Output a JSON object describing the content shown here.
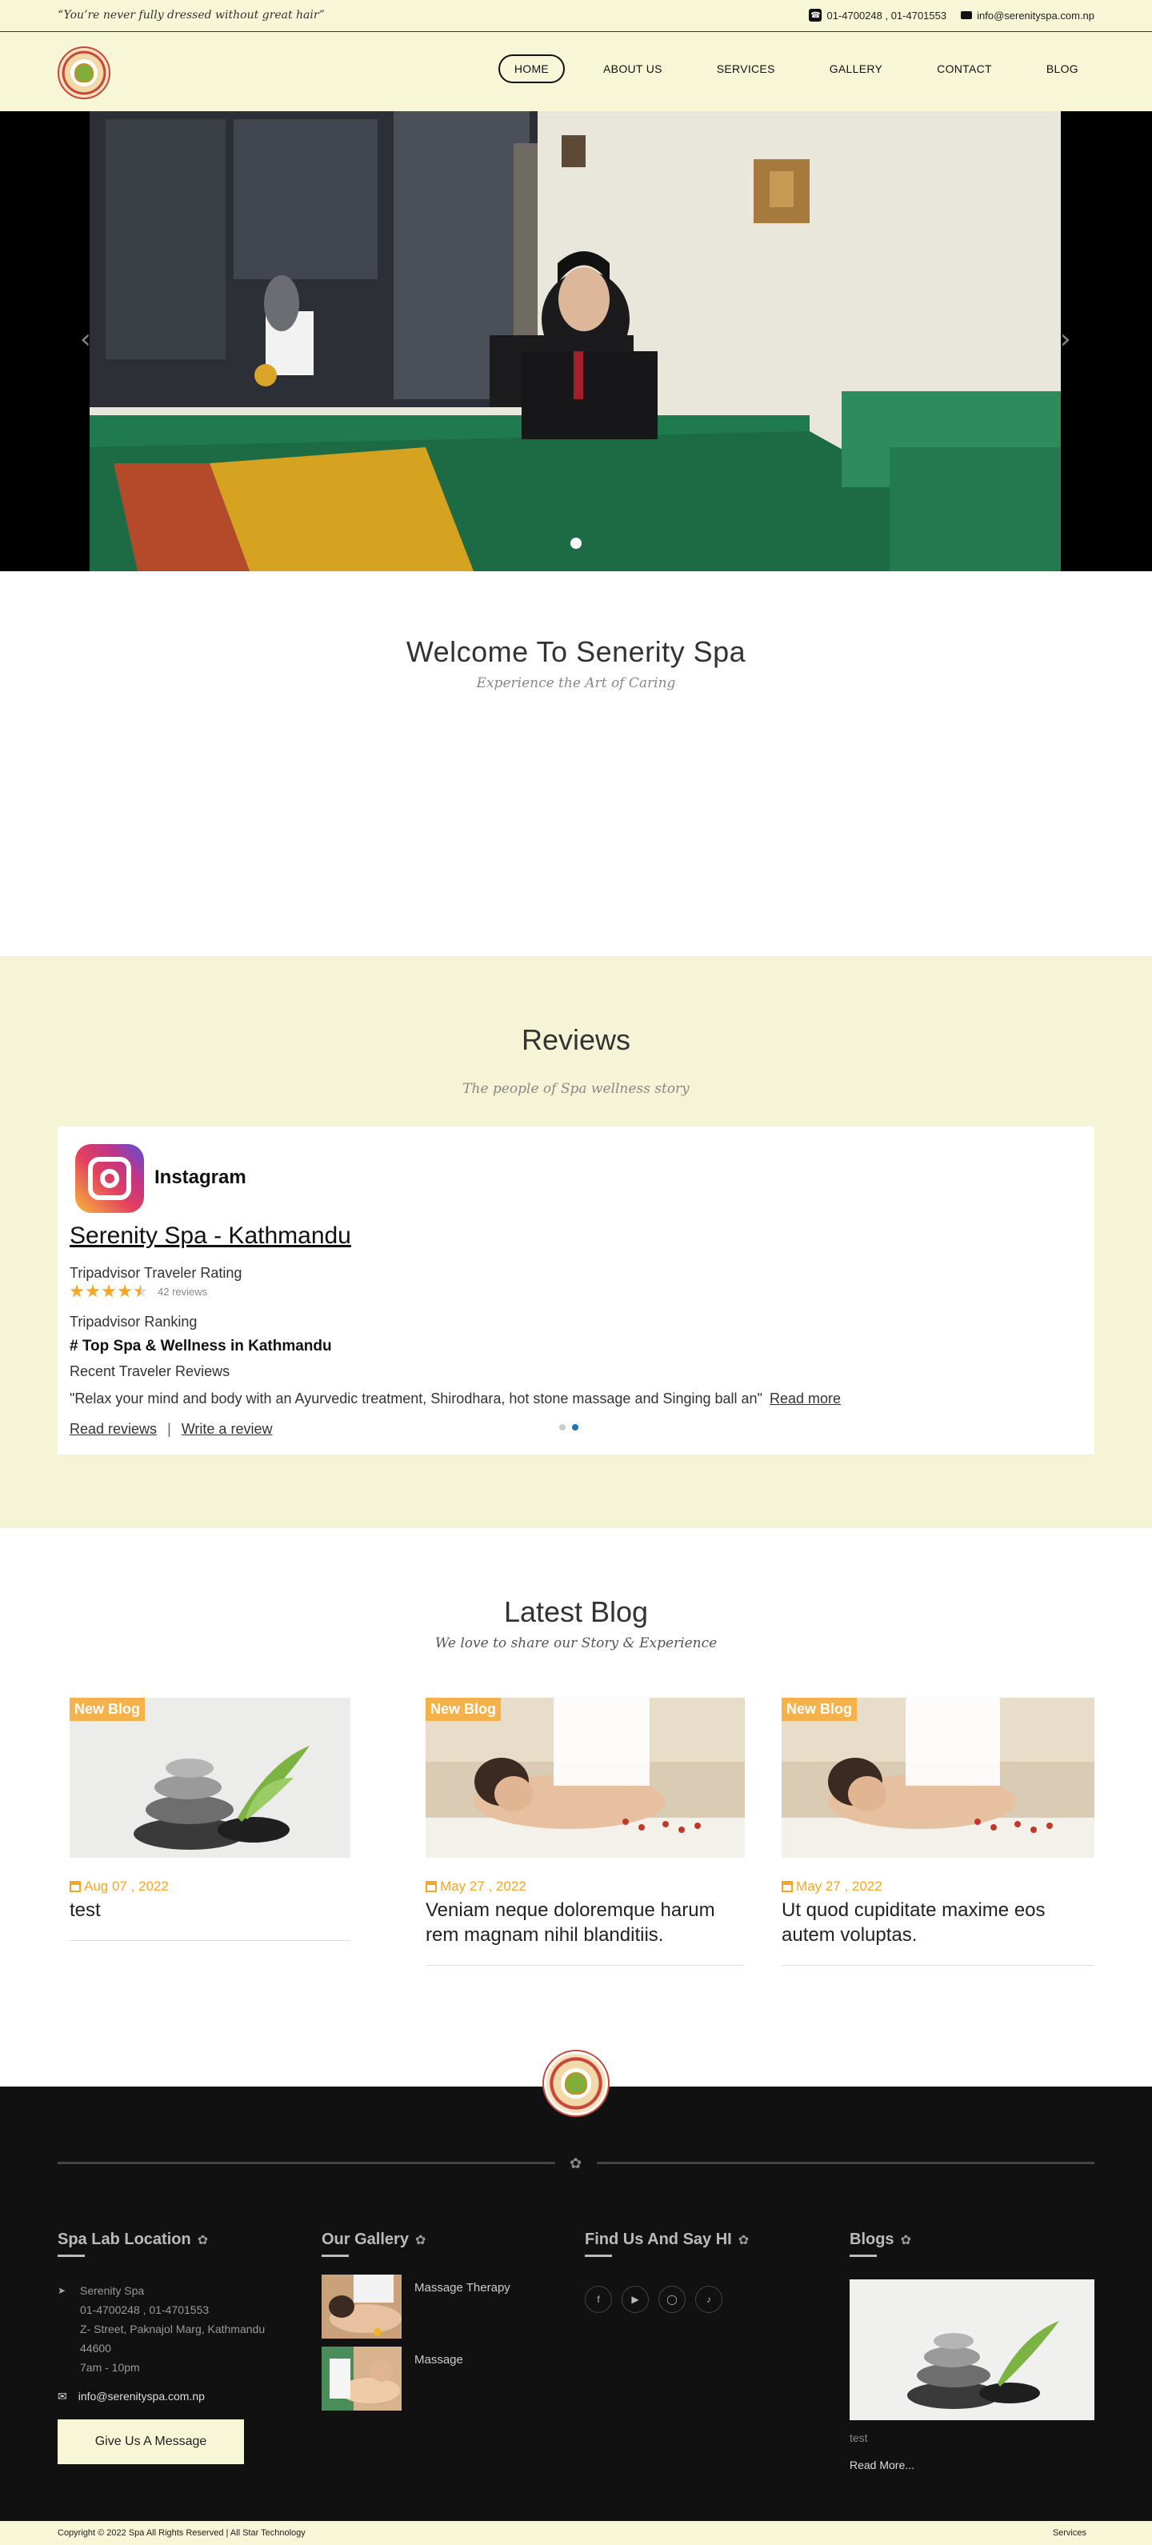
{
  "topbar": {
    "quote": "“You’re never fully dressed without great hair”",
    "phone": "01-4700248 , 01-4701553",
    "email": "info@serenityspa.com.np"
  },
  "nav": {
    "items": [
      {
        "label": "HOME",
        "active": true
      },
      {
        "label": "ABOUT US"
      },
      {
        "label": "SERVICES"
      },
      {
        "label": "GALLERY"
      },
      {
        "label": "CONTACT"
      },
      {
        "label": "BLOG"
      }
    ]
  },
  "hero": {
    "prev_icon": "chevron-left-icon",
    "next_icon": "chevron-right-icon"
  },
  "welcome": {
    "title": "Welcome To Senerity Spa",
    "subtitle": "Experience the Art of Caring"
  },
  "reviews": {
    "title": "Reviews",
    "subtitle": "The people of Spa wellness story",
    "card": {
      "platform": "Instagram",
      "business": "Serenity Spa - Kathmandu",
      "rating_label": "Tripadvisor Traveler Rating",
      "rating": 4.5,
      "review_count": "42 reviews",
      "ranking_label": "Tripadvisor Ranking",
      "ranking": "# Top Spa & Wellness in Kathmandu",
      "recent_label": "Recent Traveler Reviews",
      "quote": "\"Relax your mind and body with an Ayurvedic treatment, Shirodhara, hot stone massage and Singing ball an\"",
      "read_more": "Read more",
      "read_reviews": "Read reviews",
      "separator": "|",
      "write_review": "Write a review"
    }
  },
  "blog": {
    "title": "Latest Blog",
    "subtitle": "We love to share our Story & Experience",
    "badge": "New Blog",
    "posts": [
      {
        "date": "Aug 07 , 2022",
        "title": "test"
      },
      {
        "date": "May 27 , 2022",
        "title": "Veniam neque doloremque harum rem magnam nihil blanditiis."
      },
      {
        "date": "May 27 , 2022",
        "title": "Ut quod cupiditate maxime eos autem voluptas."
      }
    ]
  },
  "footer": {
    "location": {
      "heading": "Spa Lab Location",
      "name": "Serenity Spa",
      "phone": "01-4700248 , 01-4701553",
      "address": "Z- Street, Paknajol Marg, Kathmandu",
      "postal": "44600",
      "hours": "7am - 10pm",
      "email": "info@serenityspa.com.np",
      "button": "Give Us A Message"
    },
    "gallery": {
      "heading": "Our Gallery",
      "items": [
        {
          "label": "Massage Therapy"
        },
        {
          "label": "Massage"
        }
      ]
    },
    "social": {
      "heading": "Find Us And Say HI",
      "icons": [
        "facebook-icon",
        "youtube-icon",
        "instagram-icon",
        "tiktok-icon"
      ]
    },
    "blogs": {
      "heading": "Blogs",
      "post_title": "test",
      "read_more": "Read More..."
    }
  },
  "copyright": {
    "text": "Copyright © 2022 Spa All Rights Reserved | All Star Technology",
    "right_link": "Services"
  }
}
